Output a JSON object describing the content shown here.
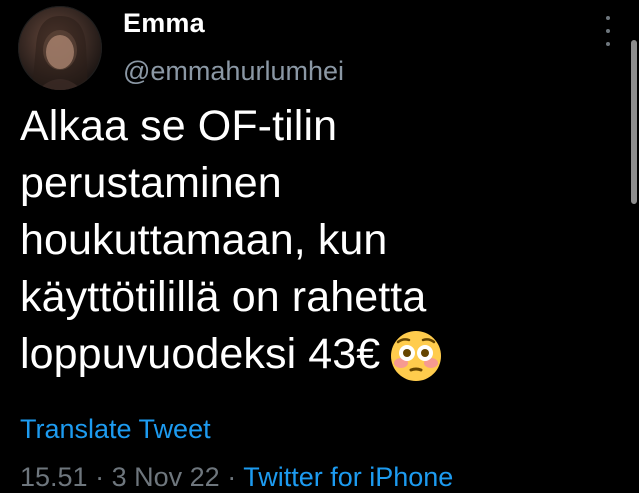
{
  "tweet": {
    "author": {
      "display_name": "Emma",
      "handle": "@emmahurlumhei",
      "avatar_icon": "profile-photo"
    },
    "more_icon": "more-vertical-icon",
    "text_lines": [
      "Alkaa se OF-tilin",
      "perustaminen",
      "houkuttamaan, kun",
      "käyttötilillä on rahetta",
      "loppuvuodeksi 43€"
    ],
    "emoji": "flushed-face-emoji",
    "translate_label": "Translate Tweet",
    "meta": {
      "time": "15.51",
      "separator": "·",
      "date": "3 Nov 22",
      "client": "Twitter for iPhone"
    }
  },
  "colors": {
    "background": "#000000",
    "text": "#ffffff",
    "secondary_text": "#8b98a5",
    "link": "#1d9bf0"
  }
}
